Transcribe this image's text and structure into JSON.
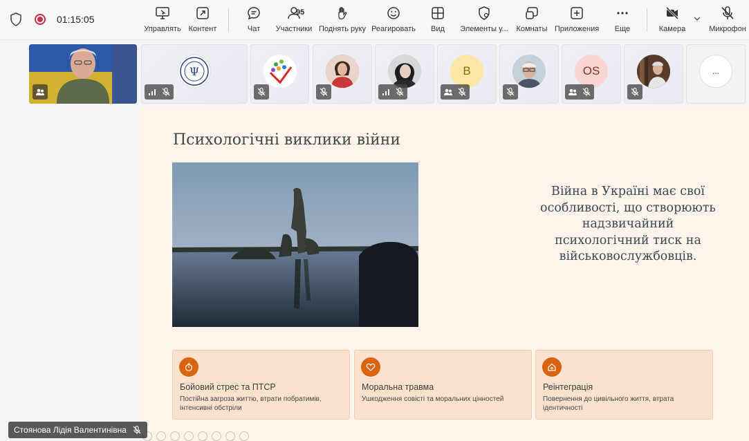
{
  "toolbar": {
    "timer": "01:15:05",
    "items": {
      "manage": "Управлять",
      "content": "Контент",
      "chat": "Чат",
      "participants": "Участники",
      "participants_count": "95",
      "raise_hand": "Поднять руку",
      "react": "Реагировать",
      "view": "Вид",
      "elements": "Элементы у...",
      "rooms": "Комнаты",
      "apps": "Приложения",
      "more": "Еще",
      "camera": "Камера",
      "mic": "Микрофон"
    }
  },
  "participants": [
    {
      "initials": ""
    },
    {
      "initials": ""
    },
    {
      "initials": ""
    },
    {
      "initials": ""
    },
    {
      "initials": ""
    },
    {
      "initials": "B"
    },
    {
      "initials": ""
    },
    {
      "initials": "OS"
    },
    {
      "initials": ""
    },
    {
      "initials": "..."
    }
  ],
  "slide": {
    "title": "Психологічні виклики війни",
    "body": "Війна в Україні має свої особливості, що створюють надзвичайний психологічний тиск на військовослужбовців.",
    "cards": [
      {
        "title": "Бойовий стрес та ПТСР",
        "desc": "Постійна загроза життю, втрати побратимів, інтенсивні обстріли",
        "icon": "stopwatch-icon"
      },
      {
        "title": "Моральна травма",
        "desc": "Ушкодження совісті та моральних цінностей",
        "icon": "heart-icon"
      },
      {
        "title": "Реінтеграція",
        "desc": "Повернення до цивільного життя, втрата ідентичності",
        "icon": "home-icon"
      }
    ],
    "accent": "#d9630f"
  },
  "presenter": {
    "name": "Стоянова Лідія Валентинівна"
  }
}
